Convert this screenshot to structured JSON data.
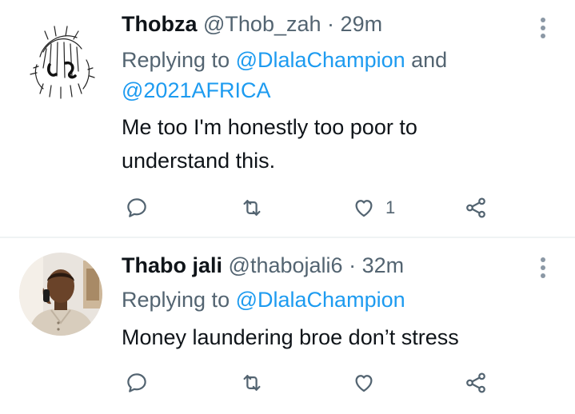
{
  "tweets": [
    {
      "name": "Thobza",
      "handle": "@Thob_zah",
      "separator": "·",
      "time": "29m",
      "replying_prefix": "Replying to",
      "mentions": [
        "@DlalaChampion",
        "@2021AFRICA"
      ],
      "mention_joiner": "and",
      "text": "Me too I'm honestly too poor to understand this.",
      "like_count": "1",
      "avatar": "sketch-drawing-avatar"
    },
    {
      "name": "Thabo jali",
      "handle": "@thabojali6",
      "separator": "·",
      "time": "32m",
      "replying_prefix": "Replying to",
      "mentions": [
        "@DlalaChampion"
      ],
      "text": "Money laundering broe don’t stress",
      "like_count": "",
      "avatar": "photo-avatar"
    }
  ],
  "colors": {
    "link": "#1d9bf0",
    "secondary_text": "#536471",
    "primary_text": "#0f1419",
    "divider": "#eff3f4"
  },
  "icons": [
    "reply-icon",
    "retweet-icon",
    "like-icon",
    "share-icon",
    "more-options-icon"
  ]
}
